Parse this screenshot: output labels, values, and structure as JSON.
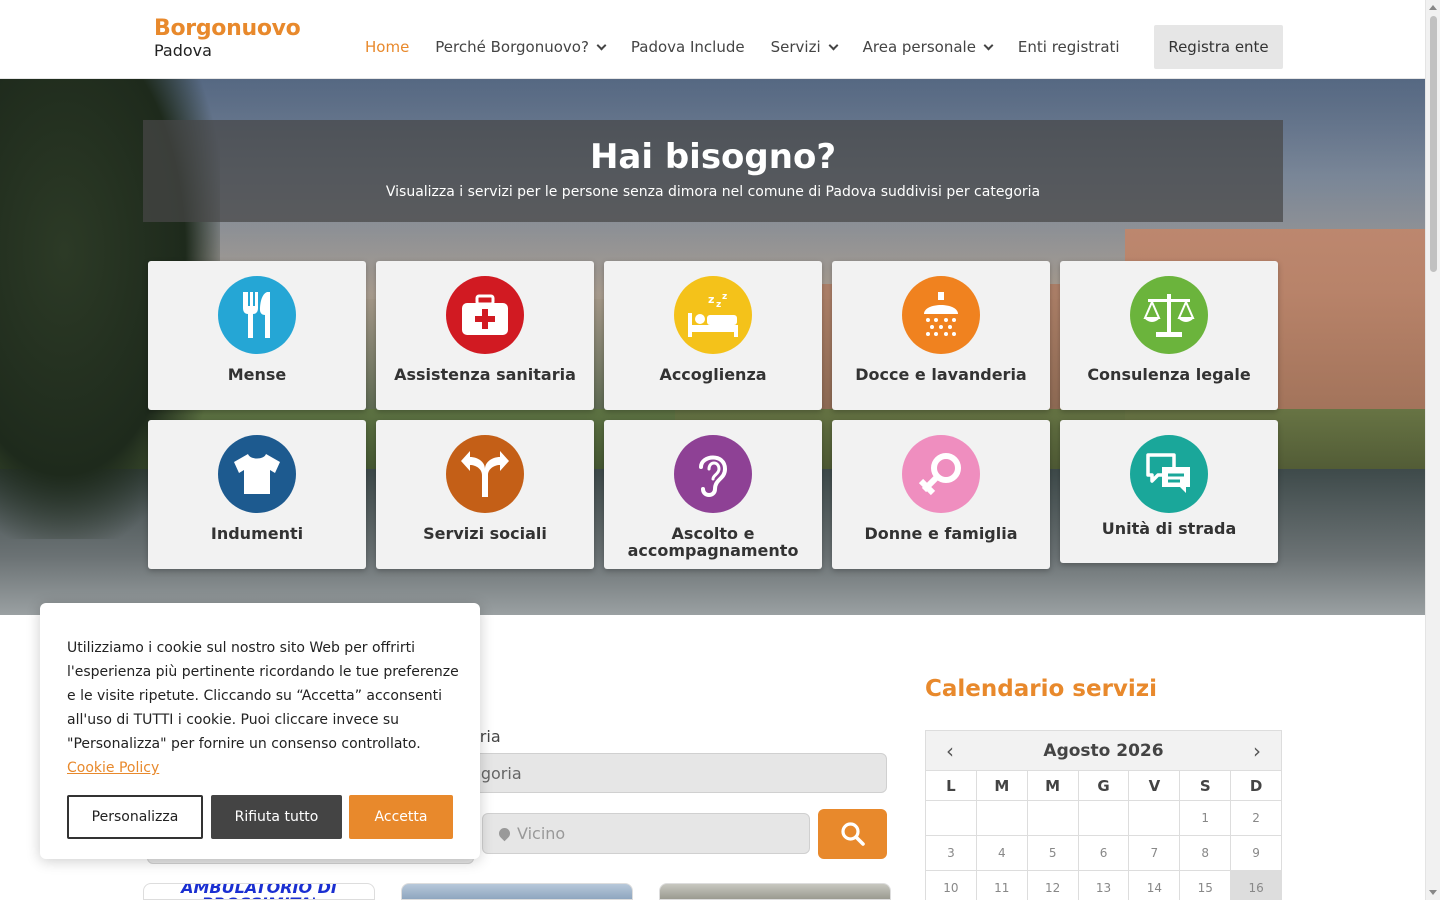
{
  "brand": {
    "name": "Borgonuovo",
    "city": "Padova"
  },
  "nav": {
    "items": [
      {
        "label": "Home",
        "active": true,
        "dropdown": false
      },
      {
        "label": "Perché Borgonuovo?",
        "active": false,
        "dropdown": true
      },
      {
        "label": "Padova Include",
        "active": false,
        "dropdown": false
      },
      {
        "label": "Servizi",
        "active": false,
        "dropdown": true
      },
      {
        "label": "Area personale",
        "active": false,
        "dropdown": true
      },
      {
        "label": "Enti registrati",
        "active": false,
        "dropdown": false
      }
    ],
    "register_label": "Registra ente"
  },
  "hero": {
    "title": "Hai bisogno?",
    "subtitle": "Visualizza i servizi per le persone senza dimora nel comune di Padova suddivisi per categoria"
  },
  "categories": [
    {
      "label": "Mense",
      "icon": "cutlery-icon",
      "color": "#25a6d5"
    },
    {
      "label": "Assistenza sanitaria",
      "icon": "first-aid-kit-icon",
      "color": "#d11a22"
    },
    {
      "label": "Accoglienza",
      "icon": "bed-icon",
      "color": "#f4c21a"
    },
    {
      "label": "Docce e lavanderia",
      "icon": "shower-icon",
      "color": "#f0821f"
    },
    {
      "label": "Consulenza legale",
      "icon": "scales-icon",
      "color": "#6bb43c"
    },
    {
      "label": "Indumenti",
      "icon": "tshirt-icon",
      "color": "#1d5a8f"
    },
    {
      "label": "Servizi sociali",
      "icon": "signpost-icon",
      "color": "#c45f17"
    },
    {
      "label": "Ascolto e accompagnamento",
      "icon": "ear-icon",
      "color": "#8e4195"
    },
    {
      "label": "Donne e famiglia",
      "icon": "female-male-icon",
      "color": "#ef8ebf"
    },
    {
      "label": "Unità di strada",
      "icon": "chat-bubbles-icon",
      "color": "#1aa79a"
    }
  ],
  "search": {
    "category_label": "oria",
    "category_value": "egoria",
    "near_placeholder": "Vicino"
  },
  "calendar": {
    "title": "Calendario servizi",
    "month": "Agosto 2026",
    "weekdays": [
      "L",
      "M",
      "M",
      "G",
      "V",
      "S",
      "D"
    ],
    "weeks": [
      [
        "",
        "",
        "",
        "",
        "",
        "1",
        "2"
      ],
      [
        "3",
        "4",
        "5",
        "6",
        "7",
        "8",
        "9"
      ],
      [
        "10",
        "11",
        "12",
        "13",
        "14",
        "15",
        "16"
      ]
    ],
    "today": "16"
  },
  "thumbnails": [
    {
      "text": "AMBULATORIO DI PROSSIMITA'"
    },
    {
      "text": ""
    },
    {
      "text": ""
    }
  ],
  "cookie": {
    "text": "Utilizziamo i cookie sul nostro sito Web per offrirti l'esperienza più pertinente ricordando le tue preferenze e le visite ripetute. Cliccando su “Accetta” acconsenti all'uso di TUTTI i cookie. Puoi cliccare invece su \"Personalizza\" per fornire un consenso controllato.",
    "link": "Cookie Policy",
    "customize": "Personalizza",
    "reject": "Rifiuta tutto",
    "accept": "Accetta"
  }
}
